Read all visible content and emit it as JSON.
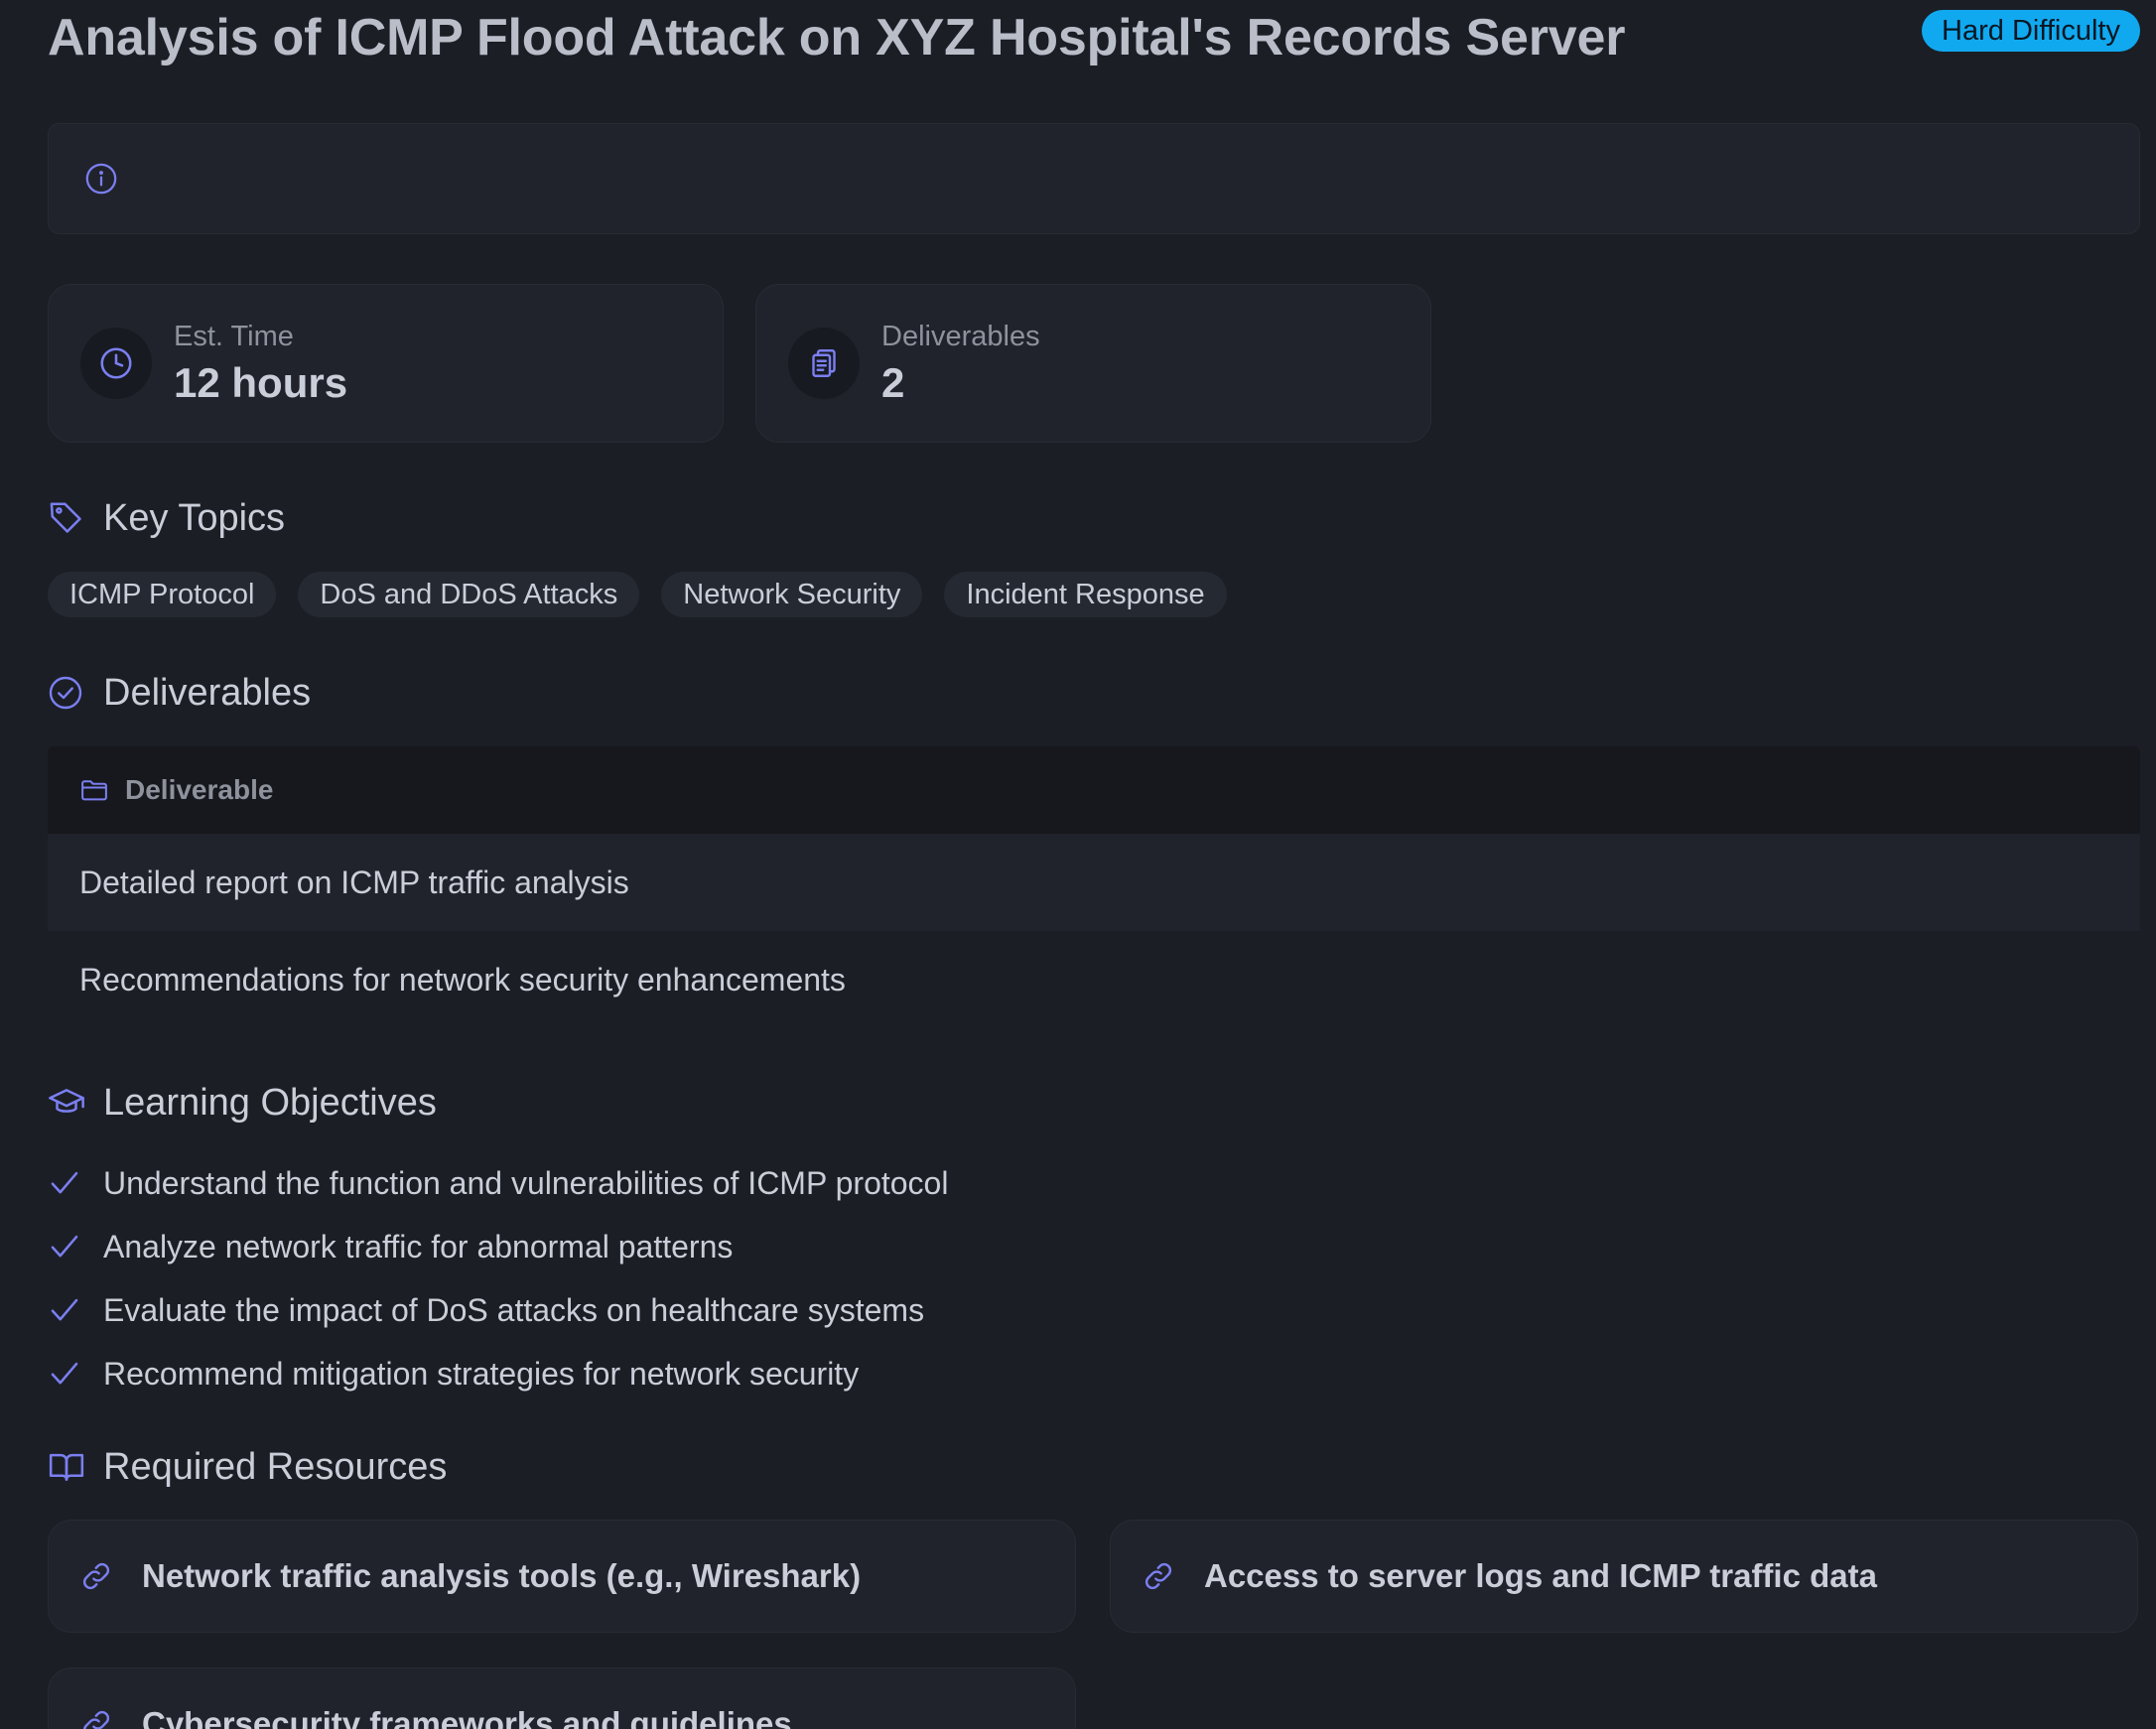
{
  "header": {
    "title": "Analysis of ICMP Flood Attack on XYZ Hospital's Records Server",
    "difficulty": "Hard Difficulty"
  },
  "info": {
    "icon": "info-icon",
    "text": ""
  },
  "stats": [
    {
      "icon": "clock-icon",
      "label": "Est. Time",
      "value": "12 hours"
    },
    {
      "icon": "clipboard-icon",
      "label": "Deliverables",
      "value": "2"
    }
  ],
  "key_topics": {
    "heading": "Key Topics",
    "icon": "tag-icon",
    "items": [
      "ICMP Protocol",
      "DoS and DDoS Attacks",
      "Network Security",
      "Incident Response"
    ]
  },
  "deliverables": {
    "heading": "Deliverables",
    "icon": "check-circle-icon",
    "column_header": "Deliverable",
    "rows": [
      "Detailed report on ICMP traffic analysis",
      "Recommendations for network security enhancements"
    ]
  },
  "learning_objectives": {
    "heading": "Learning Objectives",
    "icon": "graduation-cap-icon",
    "items": [
      "Understand the function and vulnerabilities of ICMP protocol",
      "Analyze network traffic for abnormal patterns",
      "Evaluate the impact of DoS attacks on healthcare systems",
      "Recommend mitigation strategies for network security"
    ]
  },
  "required_resources": {
    "heading": "Required Resources",
    "icon": "book-icon",
    "items": [
      "Network traffic analysis tools (e.g., Wireshark)",
      "Access to server logs and ICMP traffic data",
      "Cybersecurity frameworks and guidelines"
    ]
  },
  "colors": {
    "background": "#1b1e25",
    "card": "#20232b",
    "accent_icon": "#7b7ff0",
    "badge": "#10a9f0"
  }
}
